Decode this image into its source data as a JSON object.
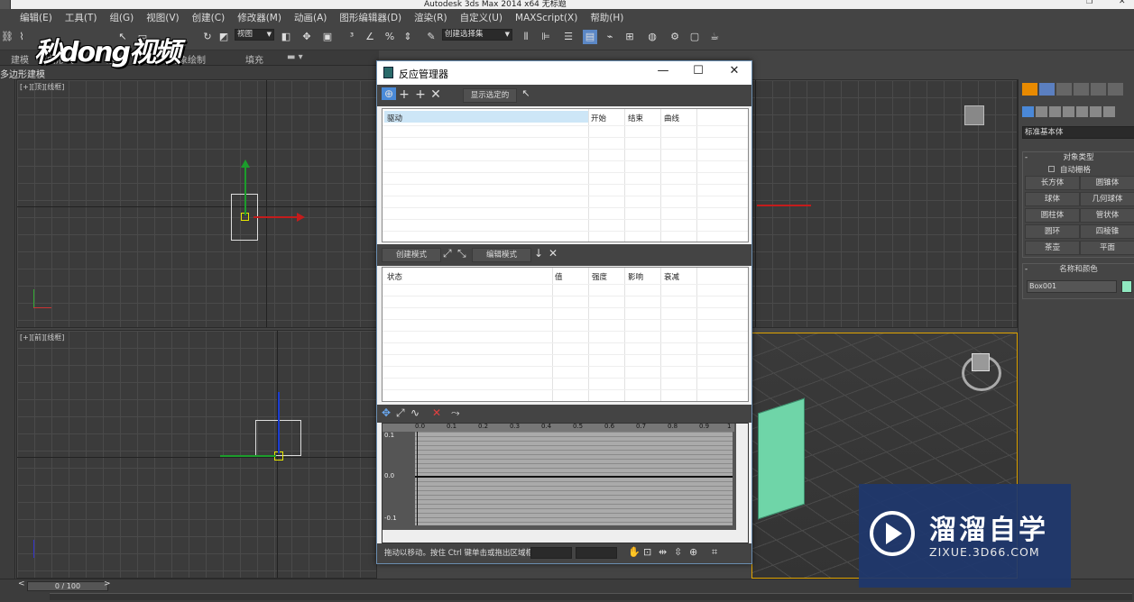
{
  "app": {
    "title": "Autodesk 3ds Max  2014 x64    无标题"
  },
  "menu": [
    "编辑(E)",
    "工具(T)",
    "组(G)",
    "视图(V)",
    "创建(C)",
    "修改器(M)",
    "动画(A)",
    "图形编辑器(D)",
    "渲染(R)",
    "自定义(U)",
    "MAXScript(X)",
    "帮助(H)"
  ],
  "toolbar": {
    "view_select": "视图",
    "selection_set": "创建选择集"
  },
  "ribbon": {
    "tabs": [
      "建模",
      "自由形式",
      "选择",
      "对象绘制",
      "填充"
    ],
    "subtab": "多边形建模"
  },
  "watermark_logo": "秒dong视频",
  "viewports": {
    "top_label": "[+][顶][线框]",
    "front_label": "[+][前][线框]"
  },
  "timeline": {
    "slider": "0 / 100"
  },
  "cmdpanel": {
    "dropdown": "标准基本体",
    "object_type_title": "对象类型",
    "autogrid": "自动栅格",
    "buttons": [
      "长方体",
      "圆锥体",
      "球体",
      "几何球体",
      "圆柱体",
      "管状体",
      "圆环",
      "四棱锥",
      "茶壶",
      "平面"
    ],
    "name_color_title": "名称和颜色",
    "object_name": "Box001",
    "object_color": "#8fe8c0"
  },
  "dialog": {
    "title": "反应管理器",
    "show_selected": "显示选定的",
    "top_list": {
      "headers": [
        "驱动",
        "开始",
        "结束",
        "曲线"
      ]
    },
    "create_mode": "创建模式",
    "edit_mode": "编辑模式",
    "bottom_list": {
      "headers": [
        "状态",
        "值",
        "强度",
        "影响",
        "衰减"
      ]
    },
    "curve": {
      "x_ticks": [
        "0.0",
        "0.1",
        "0.2",
        "0.3",
        "0.4",
        "0.5",
        "0.6",
        "0.7",
        "0.8",
        "0.9",
        "1"
      ],
      "y_ticks": [
        "0.1",
        "0.0",
        "-0.1"
      ]
    },
    "status": "拖动以移动。按住 Ctrl 键单击或拖出区域框以"
  },
  "brand": {
    "name": "溜溜自学",
    "url": "ZIXUE.3D66.COM"
  }
}
